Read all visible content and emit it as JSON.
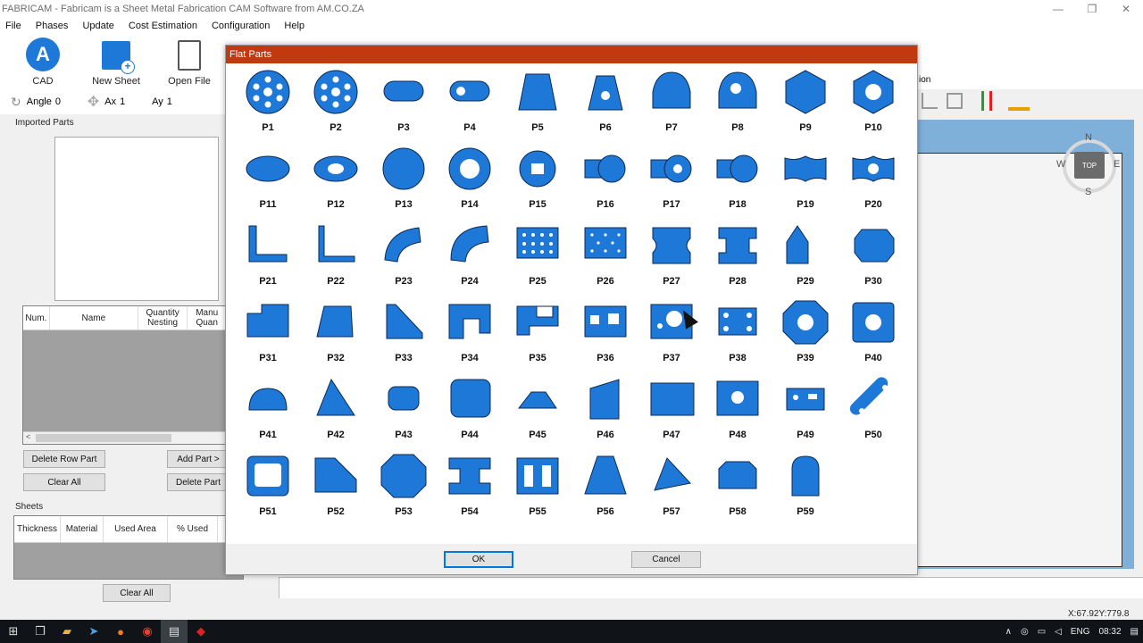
{
  "window": {
    "title": "FABRICAM - Fabricam is a Sheet Metal Fabrication CAM Software from AM.CO.ZA",
    "controls": [
      "—",
      "❐",
      "✕"
    ]
  },
  "menu": [
    "File",
    "Phases",
    "Update",
    "Cost Estimation",
    "Configuration",
    "Help"
  ],
  "toolbar": {
    "cad": "CAD",
    "new_sheet": "New Sheet",
    "open_file": "Open File",
    "section_fragment": "ion"
  },
  "transform": {
    "angle_label": "Angle",
    "angle_value": "0",
    "ax_label": "Ax",
    "ax_value": "1",
    "ay_label": "Ay",
    "ay_value": "1"
  },
  "left_panel": {
    "imported_parts_title": "Imported Parts",
    "parts_table_headers": [
      "Num.",
      "Name",
      "Quantity Nesting",
      "Manu Quan"
    ],
    "delete_row_part": "Delete Row Part",
    "add_part": "Add Part >",
    "clear_all": "Clear All",
    "delete_part": "Delete Part",
    "sheets_title": "Sheets",
    "sheets_headers": [
      "Thickness",
      "Material",
      "Used Area",
      "% Used"
    ],
    "sheets_clear_all": "Clear All"
  },
  "compass": {
    "n": "N",
    "s": "S",
    "e": "E",
    "w": "W",
    "top": "TOP"
  },
  "status": {
    "coords": "X:67.92Y:779.8"
  },
  "dialog": {
    "title": "Flat Parts",
    "ok": "OK",
    "cancel": "Cancel",
    "parts": [
      "P1",
      "P2",
      "P3",
      "P4",
      "P5",
      "P6",
      "P7",
      "P8",
      "P9",
      "P10",
      "P11",
      "P12",
      "P13",
      "P14",
      "P15",
      "P16",
      "P17",
      "P18",
      "P19",
      "P20",
      "P21",
      "P22",
      "P23",
      "P24",
      "P25",
      "P26",
      "P27",
      "P28",
      "P29",
      "P30",
      "P31",
      "P32",
      "P33",
      "P34",
      "P35",
      "P36",
      "P37",
      "P38",
      "P39",
      "P40",
      "P41",
      "P42",
      "P43",
      "P44",
      "P45",
      "P46",
      "P47",
      "P48",
      "P49",
      "P50",
      "P51",
      "P52",
      "P53",
      "P54",
      "P55",
      "P56",
      "P57",
      "P58",
      "P59"
    ],
    "fill_color": "#1e78d7"
  },
  "taskbar": {
    "lang": "ENG",
    "time": "08:32"
  }
}
